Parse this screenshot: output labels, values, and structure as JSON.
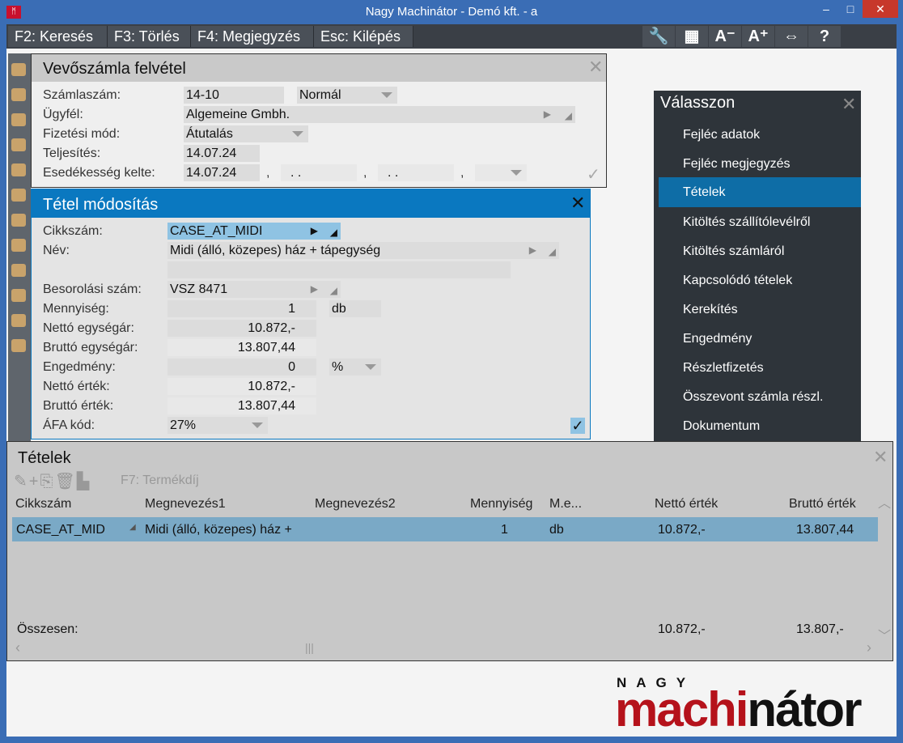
{
  "window": {
    "title": "Nagy Machinátor - Demó kft. - a",
    "minimize": "–",
    "maximize": "□",
    "close": "✕"
  },
  "toolbar": {
    "keys": [
      "F2: Keresés",
      "F3: Törlés",
      "F4: Megjegyzés",
      "Esc: Kilépés"
    ],
    "icons": [
      "wrench-icon",
      "grid-icon",
      "font-decrease-icon",
      "font-increase-icon",
      "resize-icon",
      "help-icon"
    ],
    "icon_glyphs": [
      "🔧",
      "▦",
      "A⁻",
      "A⁺",
      "⇔",
      "?"
    ]
  },
  "behind_title": "Fő",
  "invoice": {
    "title": "Vevőszámla felvétel",
    "labels": [
      "Számlaszám:",
      "Ügyfél:",
      "Fizetési mód:",
      "Teljesítés:",
      "Esedékesség kelte:"
    ],
    "number": "14-10",
    "type": "Normál",
    "customer": "Algemeine Gmbh.",
    "payment": "Átutalás",
    "fulfillment": "14.07.24",
    "due": "14.07.24",
    "date2": ". .",
    "date3": ". .",
    "sep": ","
  },
  "item_edit": {
    "title": "Tétel módosítás",
    "labels": [
      "Cikkszám:",
      "Név:",
      "Besorolási szám:",
      "Mennyiség:",
      "Nettó egységár:",
      "Bruttó egységár:",
      "Engedmény:",
      "Nettó érték:",
      "Bruttó érték:",
      "ÁFA kód:"
    ],
    "sku": "CASE_AT_MIDI",
    "name": "Midi (álló, közepes) ház + tápegység",
    "class_no": "VSZ 8471",
    "qty": "1",
    "unit": "db",
    "net_unit": "10.872,-",
    "gross_unit": "13.807,44",
    "discount": "0",
    "discount_unit": "%",
    "net_value": "10.872,-",
    "gross_value": "13.807,44",
    "vat": "27%",
    "ok": "✓"
  },
  "menu": {
    "title": "Válasszon",
    "items": [
      "Fejléc adatok",
      "Fejléc megjegyzés",
      "Tételek",
      "Kitöltés szállítólevélről",
      "Kitöltés számláról",
      "Kapcsolódó tételek",
      "Kerekítés",
      "Engedmény",
      "Részletfizetés",
      "Összevont számla részl.",
      "Dokumentum"
    ],
    "selected": 2
  },
  "items": {
    "title": "Tételek",
    "f7": "F7: Termékdíj",
    "columns": [
      "Cikkszám",
      "Megnevezés1",
      "Megnevezés2",
      "Mennyiség",
      "M.e...",
      "Nettó érték",
      "Bruttó érték"
    ],
    "rows": [
      {
        "sku": "CASE_AT_MID",
        "name1": "Midi (álló, közepes) ház +",
        "name2": "",
        "qty": "1",
        "unit": "db",
        "net": "10.872,-",
        "gross": "13.807,44"
      }
    ],
    "total_label": "Összesen:",
    "total_net": "10.872,-",
    "total_gross": "13.807,-"
  },
  "logo": {
    "top": "NAGY",
    "red": "machi",
    "black": "nátor"
  },
  "colors": {
    "accent": "#0e6da6",
    "titlebar": "#3a6db5",
    "logo_red": "#b5121b"
  }
}
